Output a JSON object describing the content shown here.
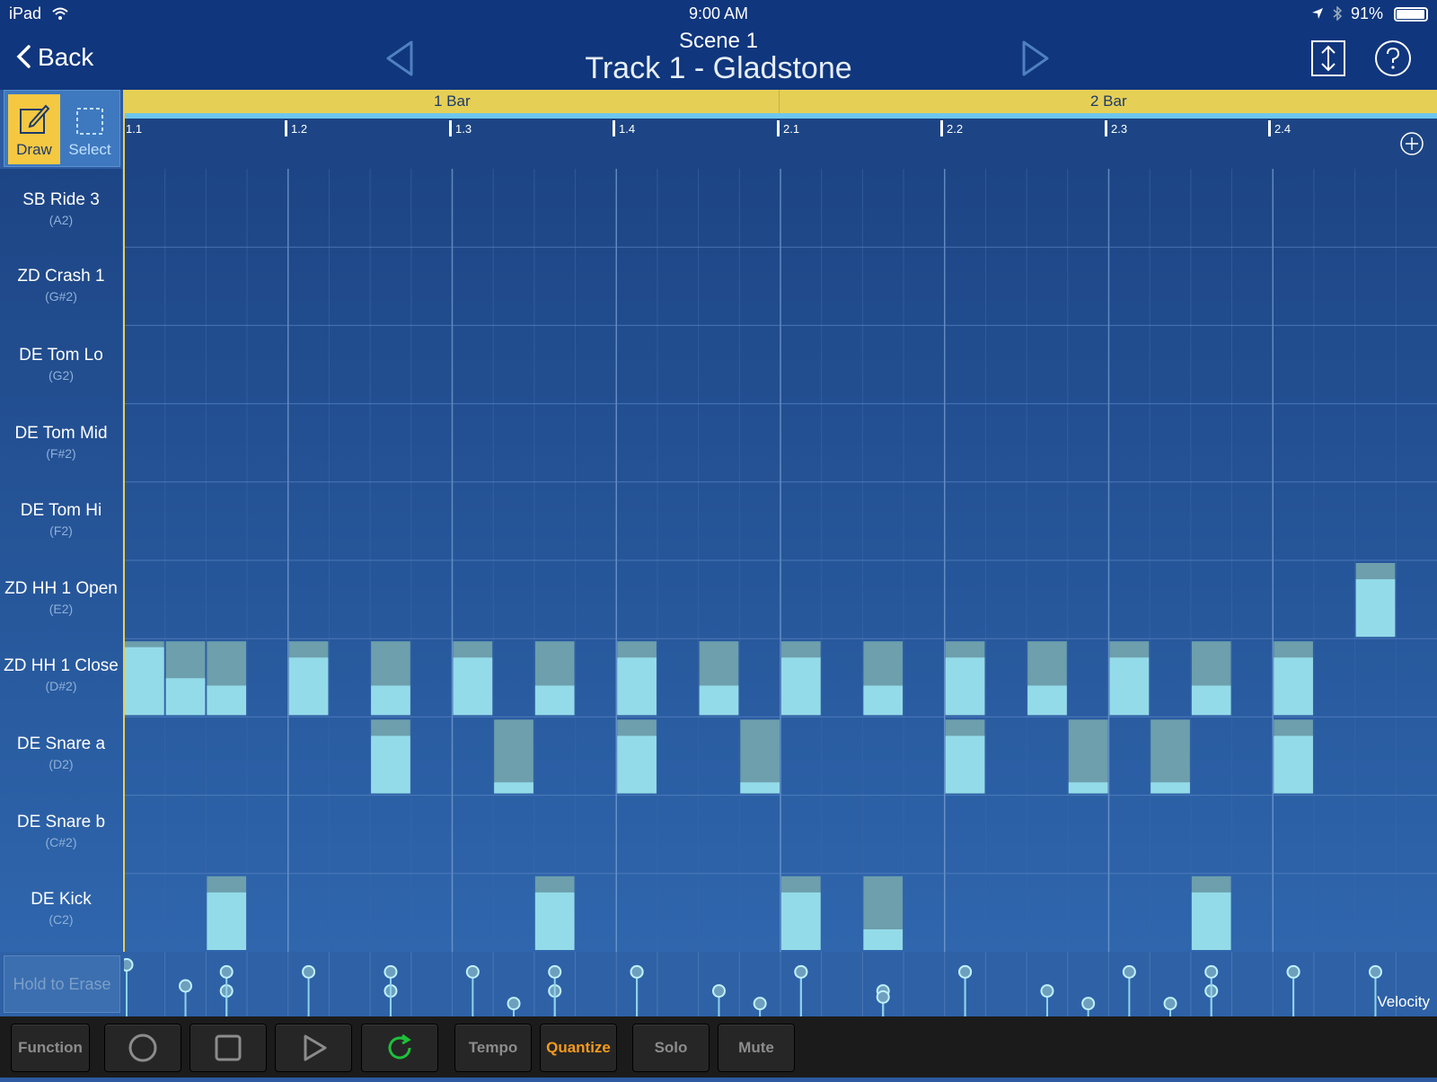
{
  "status": {
    "device": "iPad",
    "time": "9:00 AM",
    "battery": "91%"
  },
  "nav": {
    "back_label": "Back",
    "scene": "Scene  1",
    "track": "Track 1 - Gladstone"
  },
  "tools": {
    "draw_label": "Draw",
    "select_label": "Select"
  },
  "ruler": {
    "bars": [
      "1 Bar",
      "2 Bar"
    ],
    "ticks": [
      "1.1",
      "1.2",
      "1.3",
      "1.4",
      "2.1",
      "2.2",
      "2.3",
      "2.4"
    ]
  },
  "instruments": [
    {
      "name": "SB Ride 3",
      "note": "(A2)"
    },
    {
      "name": "ZD Crash 1",
      "note": "(G#2)"
    },
    {
      "name": "DE Tom Lo",
      "note": "(G2)"
    },
    {
      "name": "DE Tom Mid",
      "note": "(F#2)"
    },
    {
      "name": "DE Tom Hi",
      "note": "(F2)"
    },
    {
      "name": "ZD HH 1 Open",
      "note": "(E2)"
    },
    {
      "name": "ZD HH 1 Close",
      "note": "(D#2)"
    },
    {
      "name": "DE Snare a",
      "note": "(D2)"
    },
    {
      "name": "DE Snare b",
      "note": "(C#2)"
    },
    {
      "name": "DE Kick",
      "note": "(C2)"
    }
  ],
  "notes": [
    {
      "row": 5,
      "step": 30,
      "vel": 0.78
    },
    {
      "row": 6,
      "step": 0,
      "vel": 0.92
    },
    {
      "row": 6,
      "step": 1,
      "vel": 0.5
    },
    {
      "row": 6,
      "step": 2,
      "vel": 0.4
    },
    {
      "row": 6,
      "step": 4,
      "vel": 0.78
    },
    {
      "row": 6,
      "step": 6,
      "vel": 0.4
    },
    {
      "row": 6,
      "step": 8,
      "vel": 0.78
    },
    {
      "row": 6,
      "step": 10,
      "vel": 0.4
    },
    {
      "row": 6,
      "step": 12,
      "vel": 0.78
    },
    {
      "row": 6,
      "step": 14,
      "vel": 0.4
    },
    {
      "row": 6,
      "step": 16,
      "vel": 0.78
    },
    {
      "row": 6,
      "step": 18,
      "vel": 0.4
    },
    {
      "row": 6,
      "step": 20,
      "vel": 0.78
    },
    {
      "row": 6,
      "step": 22,
      "vel": 0.4
    },
    {
      "row": 6,
      "step": 24,
      "vel": 0.78
    },
    {
      "row": 6,
      "step": 26,
      "vel": 0.4
    },
    {
      "row": 6,
      "step": 28,
      "vel": 0.78
    },
    {
      "row": 7,
      "step": 6,
      "vel": 0.78
    },
    {
      "row": 7,
      "step": 9,
      "vel": 0.15
    },
    {
      "row": 7,
      "step": 12,
      "vel": 0.78
    },
    {
      "row": 7,
      "step": 15,
      "vel": 0.15
    },
    {
      "row": 7,
      "step": 20,
      "vel": 0.78
    },
    {
      "row": 7,
      "step": 23,
      "vel": 0.15
    },
    {
      "row": 7,
      "step": 25,
      "vel": 0.15
    },
    {
      "row": 7,
      "step": 28,
      "vel": 0.78
    },
    {
      "row": 9,
      "step": 2,
      "vel": 0.78
    },
    {
      "row": 9,
      "step": 10,
      "vel": 0.78
    },
    {
      "row": 9,
      "step": 16,
      "vel": 0.78
    },
    {
      "row": 9,
      "step": 18,
      "vel": 0.28
    },
    {
      "row": 9,
      "step": 26,
      "vel": 0.78
    }
  ],
  "velocity": {
    "erase_label": "Hold to Erase",
    "label": "Velocity"
  },
  "bottom_bar": {
    "function": "Function",
    "tempo": "Tempo",
    "quantize": "Quantize",
    "solo": "Solo",
    "mute": "Mute"
  },
  "colors": {
    "note_fill": "#94dbea",
    "note_top": "#6d9fac",
    "accent": "#e6cf55",
    "quantize": "#f39a1e"
  }
}
